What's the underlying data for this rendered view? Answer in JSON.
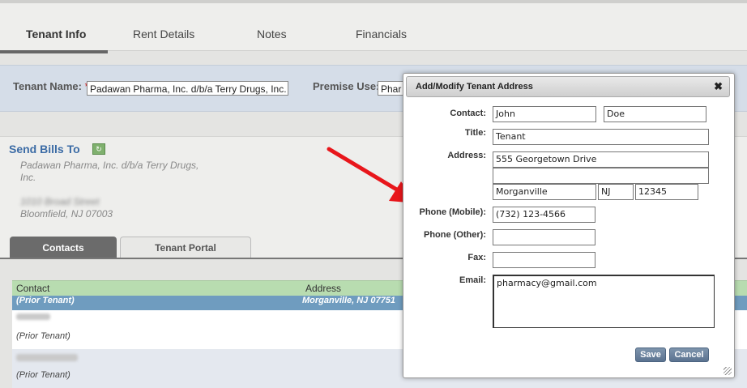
{
  "tabs": [
    "Tenant Info",
    "Rent Details",
    "Notes",
    "Financials"
  ],
  "tenant_bar": {
    "name_label": "Tenant Name:",
    "required_mark": "*",
    "name_value": "Padawan Pharma, Inc. d/b/a Terry Drugs, Inc.",
    "premise_label": "Premise Use:",
    "premise_value": "Phar"
  },
  "send_bills": {
    "title": "Send Bills To",
    "icon": "refresh-icon",
    "line1": "Padawan Pharma, Inc. d/b/a Terry Drugs,",
    "line2": "Inc.",
    "line3": "1010 Broad Street",
    "line4": "Bloomfield, NJ 07003"
  },
  "bottom_tabs": [
    "Contacts",
    "Tenant Portal"
  ],
  "grid": {
    "columns": [
      "Contact",
      "Address"
    ],
    "rows": [
      {
        "contact": "(Prior Tenant)",
        "address": "Morganville, NJ 07751"
      },
      {
        "contact": "(Prior Tenant)",
        "address": ""
      },
      {
        "contact": "(Prior Tenant)",
        "address": ""
      }
    ]
  },
  "dialog": {
    "title": "Add/Modify Tenant Address",
    "close": "✖",
    "labels": {
      "contact": "Contact:",
      "title": "Title:",
      "address": "Address:",
      "phone_mobile": "Phone (Mobile):",
      "phone_other": "Phone (Other):",
      "fax": "Fax:",
      "email": "Email:"
    },
    "values": {
      "first_name": "John",
      "last_name": "Doe",
      "title": "Tenant",
      "address1": "555 Georgetown Drive",
      "address2": "",
      "city": "Morganville",
      "state": "NJ",
      "zip": "12345",
      "phone_mobile": "(732) 123-4566",
      "phone_other": "",
      "fax": "",
      "email": "pharmacy@gmail.com"
    },
    "buttons": {
      "save": "Save",
      "cancel": "Cancel"
    }
  },
  "colors": {
    "arrow": "#e8161b",
    "title_blue": "#3b6ba5",
    "selected_row": "#6f9cbf",
    "grid_header": "#b8dcb0"
  }
}
